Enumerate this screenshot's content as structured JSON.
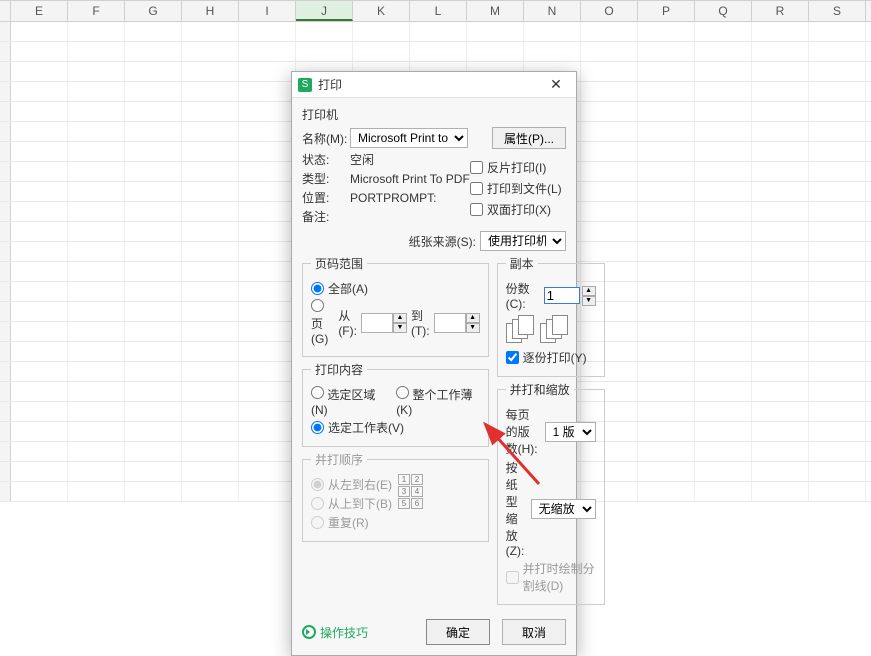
{
  "columns": [
    "E",
    "F",
    "G",
    "H",
    "I",
    "J",
    "K",
    "L",
    "M",
    "N",
    "O",
    "P",
    "Q",
    "R",
    "S"
  ],
  "active_col_index": 5,
  "dialog": {
    "title": "打印",
    "printer_section": "打印机",
    "name_label": "名称(M):",
    "name_value": "Microsoft Print to PDF",
    "properties_btn": "属性(P)...",
    "status_label": "状态:",
    "status_value": "空闲",
    "type_label": "类型:",
    "type_value": "Microsoft Print To PDF",
    "where_label": "位置:",
    "where_value": "PORTPROMPT:",
    "comment_label": "备注:",
    "reverse_print": "反片打印(I)",
    "print_to_file": "打印到文件(L)",
    "duplex_print": "双面打印(X)",
    "paper_source_label": "纸张来源(S):",
    "paper_source_value": "使用打印机设置",
    "page_range_legend": "页码范围",
    "all_label": "全部(A)",
    "pages_label": "页(G)",
    "from_label": "从(F):",
    "to_label": "到(T):",
    "copies_legend": "副本",
    "copies_label": "份数(C):",
    "copies_value": "1",
    "collate_label": "逐份打印(Y)",
    "content_legend": "打印内容",
    "selection_label": "选定区域(N)",
    "workbook_label": "整个工作薄(K)",
    "sheet_label": "选定工作表(V)",
    "order_legend": "并打顺序",
    "lr_label": "从左到右(E)",
    "tb_label": "从上到下(B)",
    "repeat_label": "重复(R)",
    "scale_legend": "并打和缩放",
    "per_page_label": "每页的版数(H):",
    "per_page_value": "1 版",
    "scale_label": "按纸型缩放(Z):",
    "scale_value": "无缩放",
    "draw_split": "并打时绘制分割线(D)",
    "tips": "操作技巧",
    "ok": "确定",
    "cancel": "取消",
    "order_cells": [
      "1",
      "2",
      "3",
      "4",
      "5",
      "6"
    ]
  }
}
